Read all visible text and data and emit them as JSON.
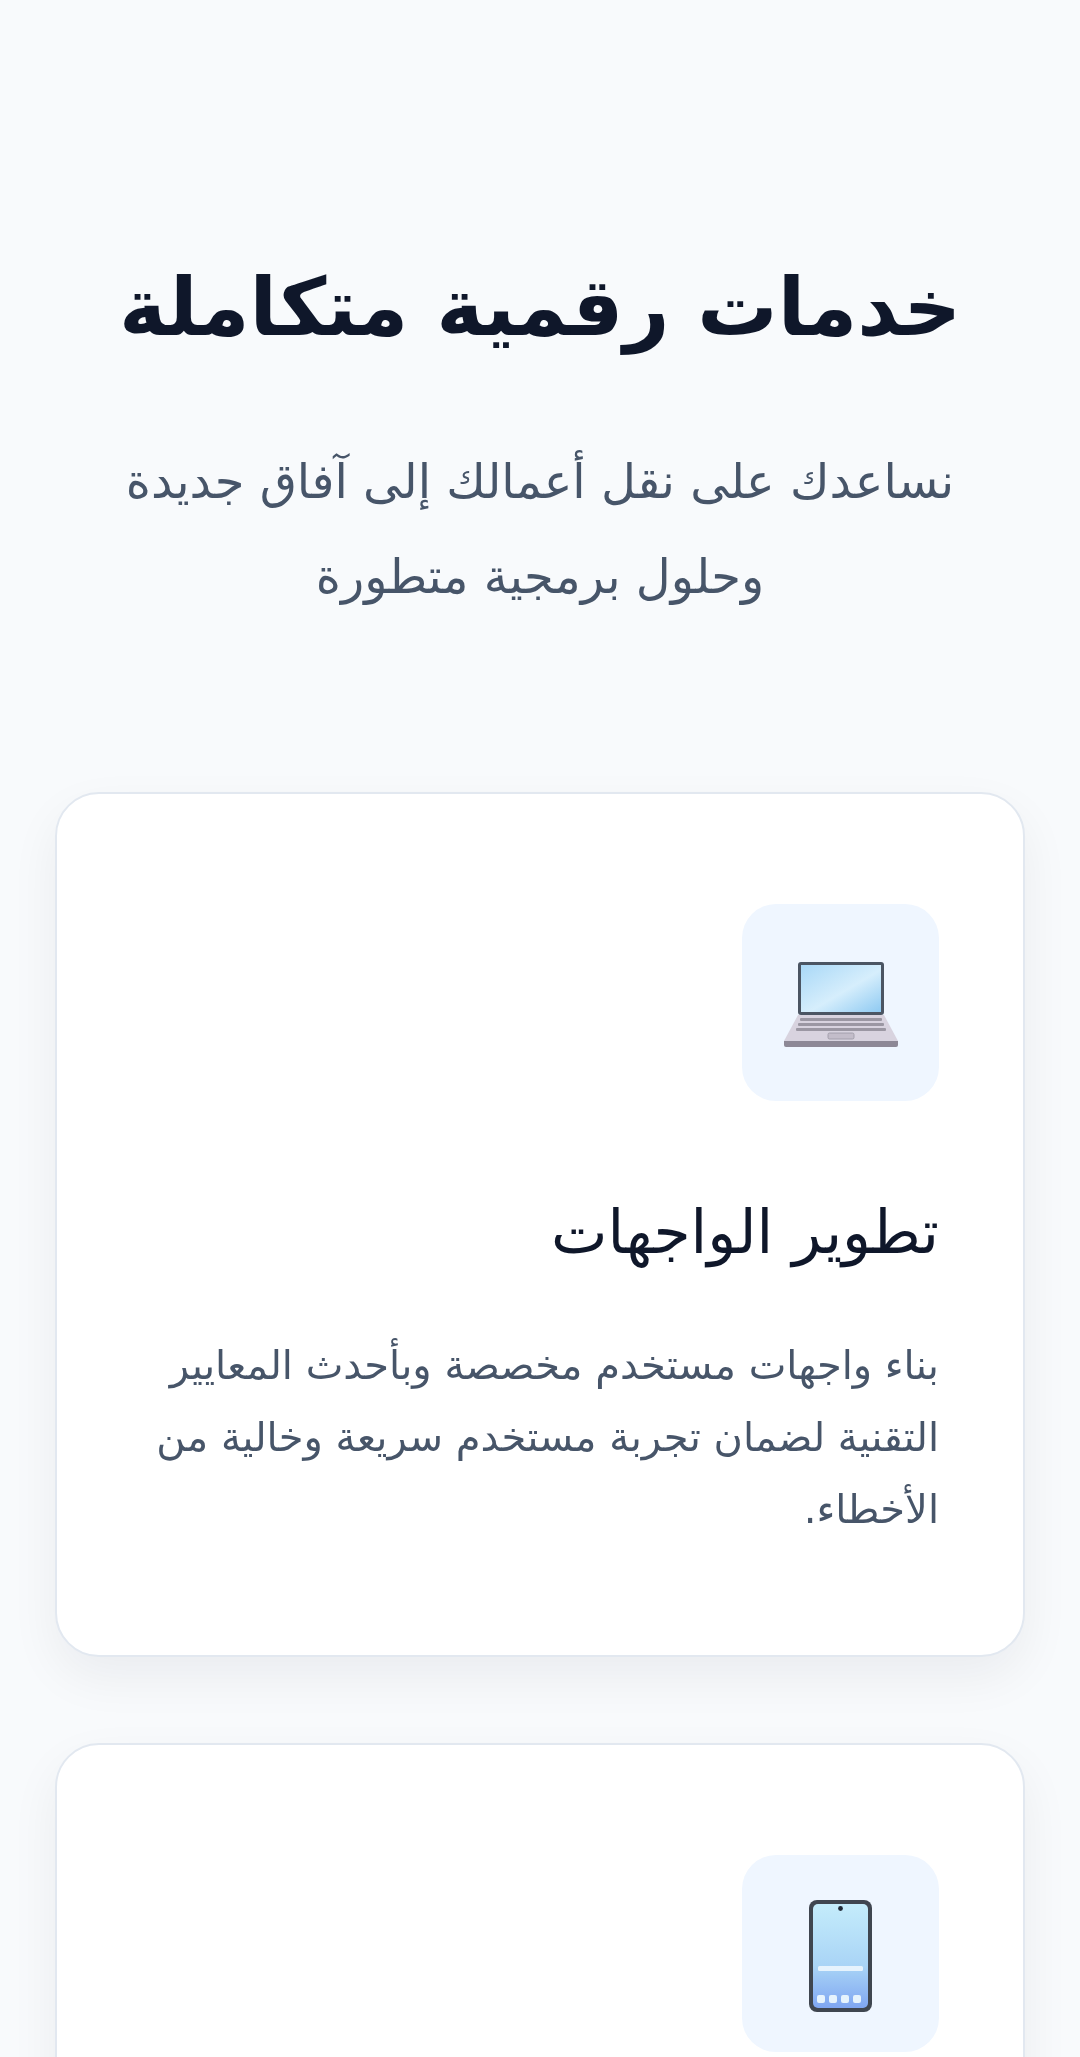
{
  "section": {
    "title": "خدمات رقمية متكاملة",
    "subtitle": "نساعدك على نقل أعمالك إلى آفاق جديدة وحلول برمجية متطورة"
  },
  "cards": [
    {
      "kind": "full",
      "title": "تطوير الواجهات",
      "description": "بناء واجهات مستخدم مخصصة وبأحدث المعايير التقنية لضمان تجربة مستخدم سريعة وخالية من الأخطاء."
    },
    {
      "kind": "partial"
    }
  ]
}
